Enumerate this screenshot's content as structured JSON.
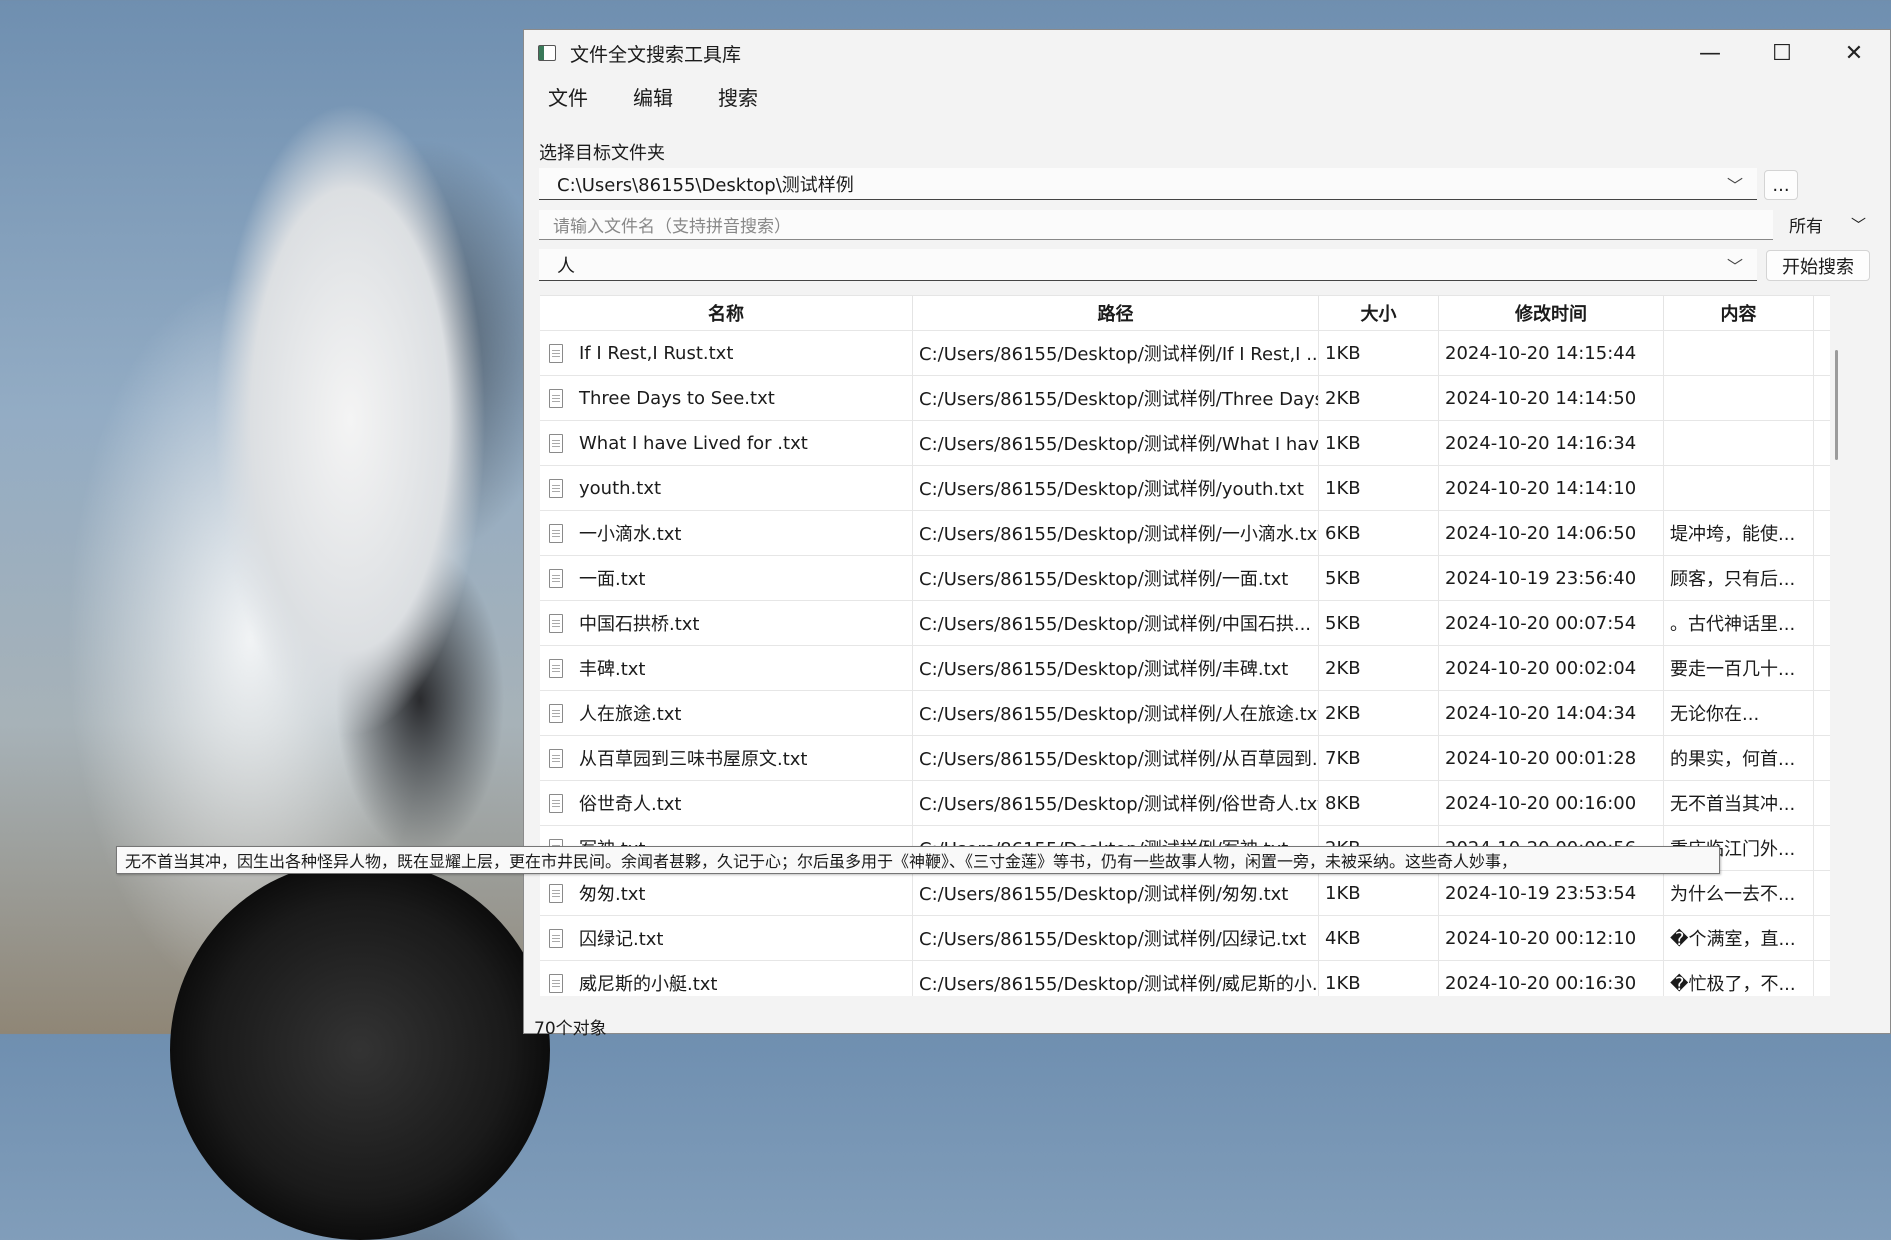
{
  "window": {
    "title": "文件全文搜索工具库",
    "controls": {
      "minimize": "—",
      "maximize": "☐",
      "close": "✕"
    }
  },
  "menu": [
    "文件",
    "编辑",
    "搜索"
  ],
  "folder": {
    "label": "选择目标文件夹",
    "value": "C:\\Users\\86155\\Desktop\\测试样例",
    "browse_label": "..."
  },
  "filename": {
    "placeholder": "请输入文件名（支持拼音搜索）",
    "filter_value": "所有"
  },
  "query": {
    "value": "人",
    "button_label": "开始搜索"
  },
  "table": {
    "headers": [
      "名称",
      "路径",
      "大小",
      "修改时间",
      "内容"
    ],
    "rows": [
      [
        "If I Rest,I Rust.txt",
        "C:/Users/86155/Desktop/测试样例/If I Rest,I ...",
        "1KB",
        "2024-10-20 14:15:44",
        ""
      ],
      [
        "Three Days to See.txt",
        "C:/Users/86155/Desktop/测试样例/Three Days ...",
        "2KB",
        "2024-10-20 14:14:50",
        ""
      ],
      [
        "What I have Lived for .txt",
        "C:/Users/86155/Desktop/测试样例/What I have...",
        "1KB",
        "2024-10-20 14:16:34",
        ""
      ],
      [
        "youth.txt",
        "C:/Users/86155/Desktop/测试样例/youth.txt",
        "1KB",
        "2024-10-20 14:14:10",
        ""
      ],
      [
        "一小滴水.txt",
        "C:/Users/86155/Desktop/测试样例/一小滴水.txt",
        "6KB",
        "2024-10-20 14:06:50",
        "堤冲垮，能使..."
      ],
      [
        "一面.txt",
        "C:/Users/86155/Desktop/测试样例/一面.txt",
        "5KB",
        "2024-10-19 23:56:40",
        "顾客，只有后..."
      ],
      [
        "中国石拱桥.txt",
        "C:/Users/86155/Desktop/测试样例/中国石拱...",
        "5KB",
        "2024-10-20 00:07:54",
        "。古代神话里..."
      ],
      [
        "丰碑.txt",
        "C:/Users/86155/Desktop/测试样例/丰碑.txt",
        "2KB",
        "2024-10-20 00:02:04",
        "要走一百几十..."
      ],
      [
        "人在旅途.txt",
        "C:/Users/86155/Desktop/测试样例/人在旅途.txt",
        "2KB",
        "2024-10-20 14:04:34",
        "无论你在..."
      ],
      [
        "从百草园到三味书屋原文.txt",
        "C:/Users/86155/Desktop/测试样例/从百草园到...",
        "7KB",
        "2024-10-20 00:01:28",
        "的果实，何首..."
      ],
      [
        "俗世奇人.txt",
        "C:/Users/86155/Desktop/测试样例/俗世奇人.txt",
        "8KB",
        "2024-10-20 00:16:00",
        "无不首当其冲..."
      ],
      [
        "军神.txt",
        "C:/Users/86155/Desktop/测试样例/军神.txt",
        "2KB",
        "2024-10-20 00:09:56",
        "重庆临江门外..."
      ],
      [
        "匆匆.txt",
        "C:/Users/86155/Desktop/测试样例/匆匆.txt",
        "1KB",
        "2024-10-19 23:53:54",
        "为什么一去不..."
      ],
      [
        "囚绿记.txt",
        "C:/Users/86155/Desktop/测试样例/囚绿记.txt",
        "4KB",
        "2024-10-20 00:12:10",
        "�个满室，直..."
      ],
      [
        "威尼斯的小艇.txt",
        "C:/Users/86155/Desktop/测试样例/威尼斯的小...",
        "1KB",
        "2024-10-20 00:16:30",
        "�忙极了，不..."
      ]
    ]
  },
  "tooltip": "无不首当其冲，因生出各种怪异人物，既在显耀上层，更在市井民间。余闻者甚夥，久记于心；尔后虽多用于《神鞭》、《三寸金莲》等书，仍有一些故事人物，闲置一旁，未被采纳。这些奇人妙事，",
  "status": "70个对象"
}
